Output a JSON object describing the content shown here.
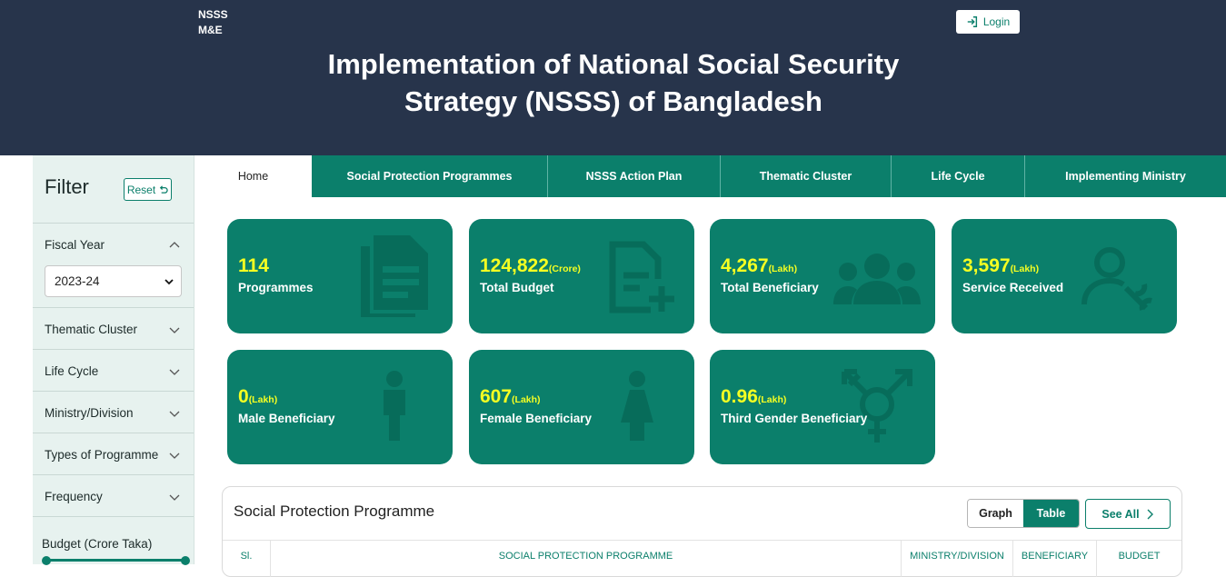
{
  "header": {
    "brand_line1": "NSSS",
    "brand_line2": "M&E",
    "login_label": "Login",
    "title_line1": "Implementation of National Social Security",
    "title_line2": "Strategy (NSSS) of Bangladesh"
  },
  "sidebar": {
    "title": "Filter",
    "reset_label": "Reset",
    "fiscal_year_label": "Fiscal Year",
    "fiscal_year_value": "2023-24",
    "items": [
      {
        "label": "Thematic Cluster"
      },
      {
        "label": "Life Cycle"
      },
      {
        "label": "Ministry/Division"
      },
      {
        "label": "Types of Programme"
      },
      {
        "label": "Frequency"
      }
    ],
    "budget_label": "Budget (Crore Taka)"
  },
  "tabs": [
    {
      "label": "Home",
      "active": true
    },
    {
      "label": "Social Protection Programmes"
    },
    {
      "label": "NSSS Action Plan"
    },
    {
      "label": "Thematic Cluster"
    },
    {
      "label": "Life Cycle"
    },
    {
      "label": "Implementing Ministry"
    }
  ],
  "cards": [
    {
      "value": "114",
      "unit": "",
      "label": "Programmes",
      "icon": "document-icon"
    },
    {
      "value": "124,822",
      "unit": "(Crore)",
      "label": "Total Budget",
      "icon": "document-add-icon"
    },
    {
      "value": "4,267",
      "unit": "(Lakh)",
      "label": "Total Beneficiary",
      "icon": "people-group-icon"
    },
    {
      "value": "3,597",
      "unit": "(Lakh)",
      "label": "Service Received",
      "icon": "user-wrench-icon"
    },
    {
      "value": "0",
      "unit": "(Lakh)",
      "label": "Male Beneficiary",
      "icon": "male-icon"
    },
    {
      "value": "607",
      "unit": "(Lakh)",
      "label": "Female Beneficiary",
      "icon": "female-icon"
    },
    {
      "value": "0.96",
      "unit": "(Lakh)",
      "label": "Third Gender Beneficiary",
      "icon": "transgender-icon"
    }
  ],
  "programme_panel": {
    "title": "Social Protection Programme",
    "graph_label": "Graph",
    "table_label": "Table",
    "see_all_label": "See All",
    "columns": [
      "Sl.",
      "SOCIAL PROTECTION PROGRAMME",
      "MINISTRY/DIVISION",
      "BENEFICIARY",
      "BUDGET"
    ]
  },
  "colors": {
    "header_bg": "#27344b",
    "accent": "#0b7f6b",
    "highlight_value": "#f5ff22",
    "sidebar_bg": "#e7f2ef"
  }
}
